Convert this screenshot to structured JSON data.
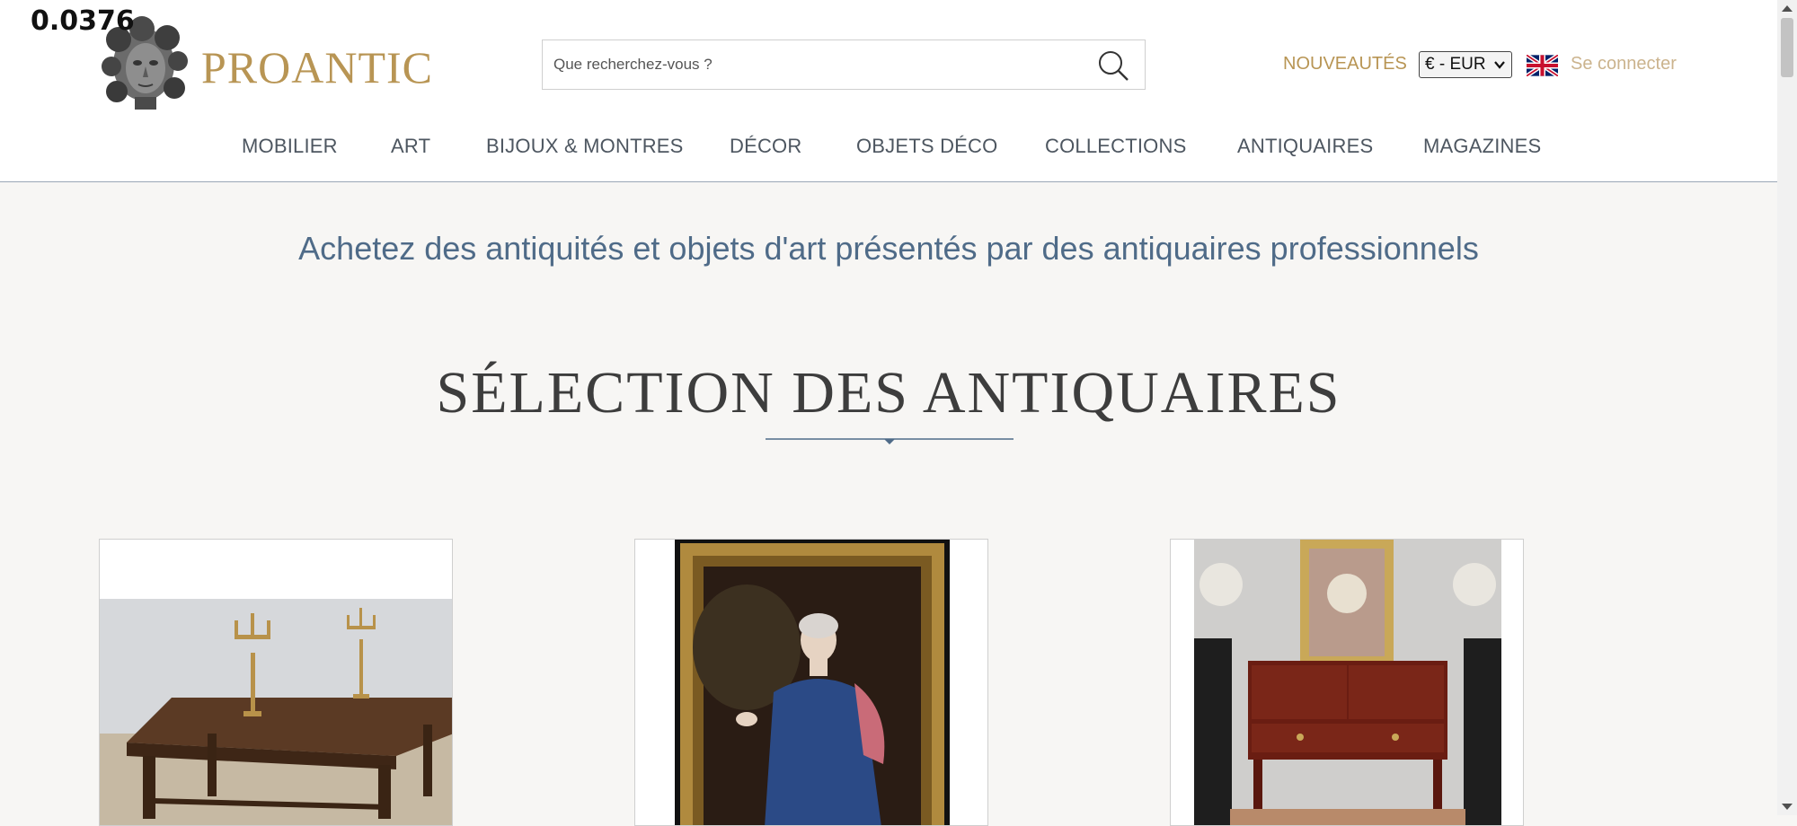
{
  "overlay": {
    "value": "0.0376"
  },
  "header": {
    "logo_text": "PROANTIC",
    "search": {
      "placeholder": "Que recherchez-vous ?",
      "value": ""
    },
    "new_label": "NOUVEAUTÉS",
    "currency": "€ - EUR",
    "language_flag_icon": "uk-flag-icon",
    "login_label": "Se connecter"
  },
  "nav": {
    "items": [
      {
        "label": "MOBILIER"
      },
      {
        "label": "ART"
      },
      {
        "label": "BIJOUX & MONTRES"
      },
      {
        "label": "DÉCOR"
      },
      {
        "label": "OBJETS DÉCO"
      },
      {
        "label": "COLLECTIONS"
      },
      {
        "label": "ANTIQUAIRES"
      },
      {
        "label": "MAGAZINES"
      }
    ]
  },
  "main": {
    "tagline": "Achetez des antiquités et objets d'art présentés par des antiquaires professionnels",
    "section_title": "SÉLECTION DES ANTIQUAIRES",
    "cards": [
      {
        "image": "antique-dining-table-with-candelabras"
      },
      {
        "image": "gilt-framed-portrait-of-lady"
      },
      {
        "image": "mahogany-console-with-mirror-and-chandeliers"
      }
    ]
  },
  "colors": {
    "brand_gold": "#b89554",
    "nav_text": "#4d5660",
    "tagline_blue": "#4f6b88",
    "background": "#f7f6f4"
  }
}
